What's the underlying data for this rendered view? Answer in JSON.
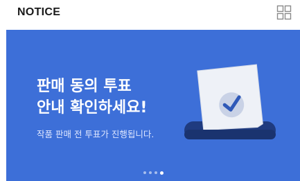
{
  "header": {
    "title": "NOTICE",
    "grid_icon": "grid-view-icon"
  },
  "banner": {
    "headline_line1": "판매 동의 투표",
    "headline_line2": "안내 확인하세요!",
    "subtext": "작품 판매 전 투표가 진행됩니다.",
    "illustration_icon": "ballot-checkmark-icon",
    "background_color": "#3d6fd8",
    "pager": {
      "total": 4,
      "active_index": 3
    }
  }
}
